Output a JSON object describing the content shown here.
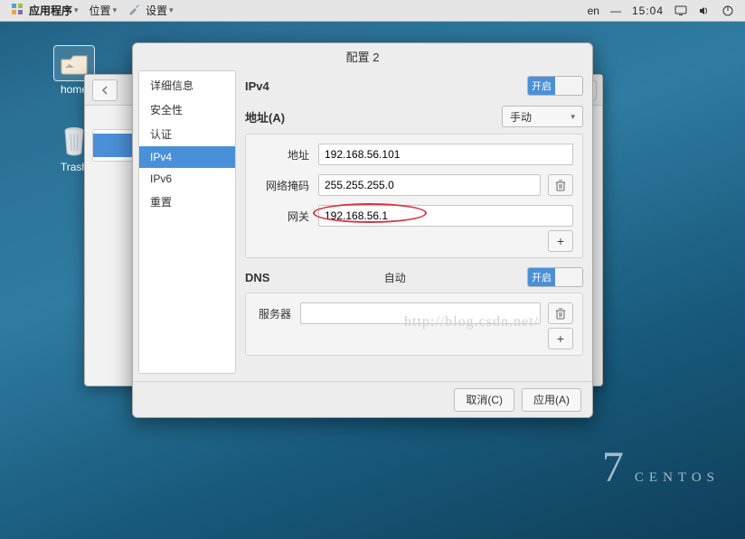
{
  "panel": {
    "apps_label": "应用程序",
    "places_label": "位置",
    "settings_label": "设置",
    "lang": "en",
    "clock": "15:04"
  },
  "desktop": {
    "home": "home",
    "trash": "Trash"
  },
  "dlg": {
    "title": "配置 2",
    "sidebar": {
      "details": "详细信息",
      "security": "安全性",
      "auth": "认证",
      "ipv4": "IPv4",
      "ipv6": "IPv6",
      "reset": "重置"
    },
    "ipv4": {
      "header": "IPv4",
      "toggle_label": "开启",
      "addresses_label": "地址(A)",
      "method": "手动",
      "addr_label": "地址",
      "addr_value": "192.168.56.101",
      "mask_label": "网络掩码",
      "mask_value": "255.255.255.0",
      "gw_label": "网关",
      "gw_value": "192.168.56.1"
    },
    "dns": {
      "header": "DNS",
      "auto_label": "自动",
      "toggle_label": "开启",
      "server_label": "服务器",
      "server_value": ""
    },
    "footer": {
      "cancel": "取消(C)",
      "apply": "应用(A)"
    }
  },
  "watermark": "http://blog.csdn.net/",
  "centos": {
    "num": "7",
    "name": "CENTOS"
  }
}
